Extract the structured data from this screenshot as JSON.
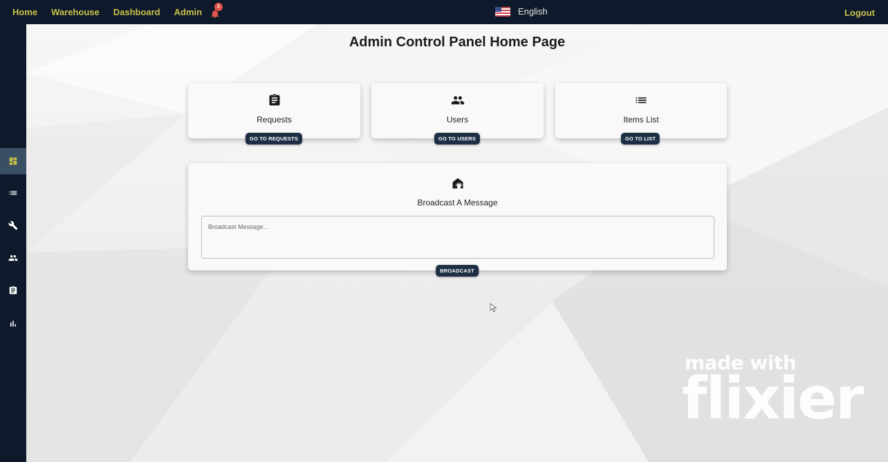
{
  "nav": {
    "links": [
      "Home",
      "Warehouse",
      "Dashboard",
      "Admin"
    ],
    "notification_count": "1",
    "language": "English",
    "logout": "Logout"
  },
  "sidebar": {
    "items": [
      {
        "icon": "dashboard-icon",
        "active": true
      },
      {
        "icon": "list-icon",
        "active": false
      },
      {
        "icon": "wrench-icon",
        "active": false
      },
      {
        "icon": "people-icon",
        "active": false
      },
      {
        "icon": "clipboard-icon",
        "active": false
      },
      {
        "icon": "bar-chart-icon",
        "active": false
      }
    ]
  },
  "page": {
    "title": "Admin Control Panel Home Page"
  },
  "cards": [
    {
      "icon": "clipboard-icon",
      "title": "Requests",
      "button": "GO TO REQUESTS"
    },
    {
      "icon": "people-icon",
      "title": "Users",
      "button": "GO TO USERS"
    },
    {
      "icon": "list-icon",
      "title": "Items List",
      "button": "GO TO LIST"
    }
  ],
  "broadcast": {
    "icon": "broadcast-icon",
    "title": "Broadcast A Message",
    "placeholder": "Broadcast Message...",
    "value": "",
    "button": "BROADCAST"
  },
  "watermark": {
    "line1": "made with",
    "line2": "flixier"
  },
  "colors": {
    "navbar": "#0e1a2b",
    "nav_link": "#c9c24a",
    "button": "#1e2f45",
    "badge": "#e0544a",
    "sidebar_active": "#3a4f63"
  }
}
